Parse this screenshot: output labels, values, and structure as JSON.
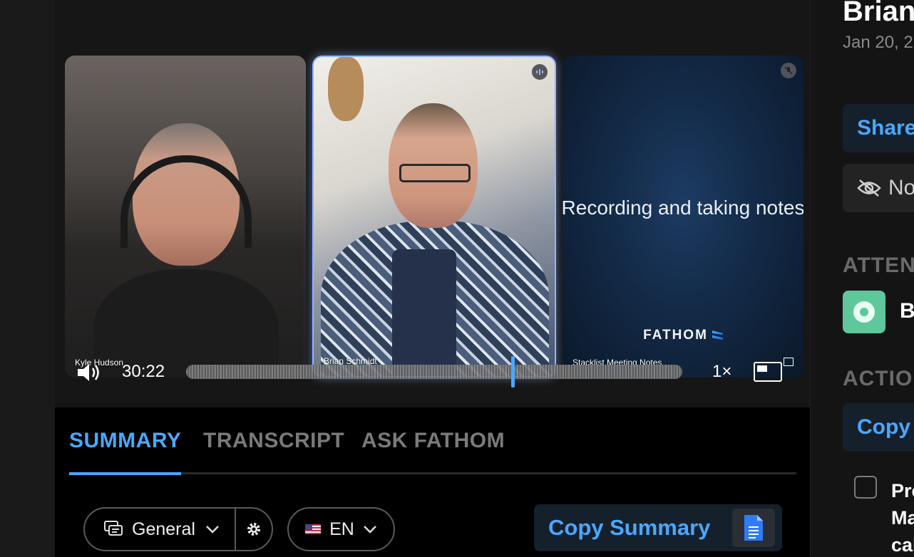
{
  "participants": [
    {
      "name": "Kyle Hudson"
    },
    {
      "name": "Brian Schmidt",
      "status": "speaking"
    },
    {
      "name": "Stacklist Meeting Notes",
      "status": "muted",
      "overlay_text": "Recording and taking notes",
      "brand": "FATHOM"
    }
  ],
  "player": {
    "time": "30:22",
    "speed": "1×",
    "progress_fraction": 0.655,
    "icons": {
      "volume": "volume-icon",
      "pip": "picture-in-picture-icon",
      "expand": "expand-icon"
    }
  },
  "tabs": [
    {
      "label": "SUMMARY",
      "active": true
    },
    {
      "label": "TRANSCRIPT",
      "active": false
    },
    {
      "label": "ASK FATHOM",
      "active": false
    }
  ],
  "toolbar": {
    "template_label": "General",
    "language_label": "EN",
    "copy_summary_label": "Copy Summary"
  },
  "sidebar": {
    "title": "Brian",
    "date": "Jan 20, 2",
    "share_label": "Share",
    "no_label": "No",
    "attendees_heading": "ATTEN",
    "attendee_initial": "B",
    "actions_heading": "ACTIO",
    "copy_label": "Copy",
    "action_item_lines": [
      "Pro",
      "Ma",
      "cal"
    ]
  },
  "colors": {
    "accent": "#4aa8ff",
    "background": "#000000",
    "panel": "#161616"
  }
}
